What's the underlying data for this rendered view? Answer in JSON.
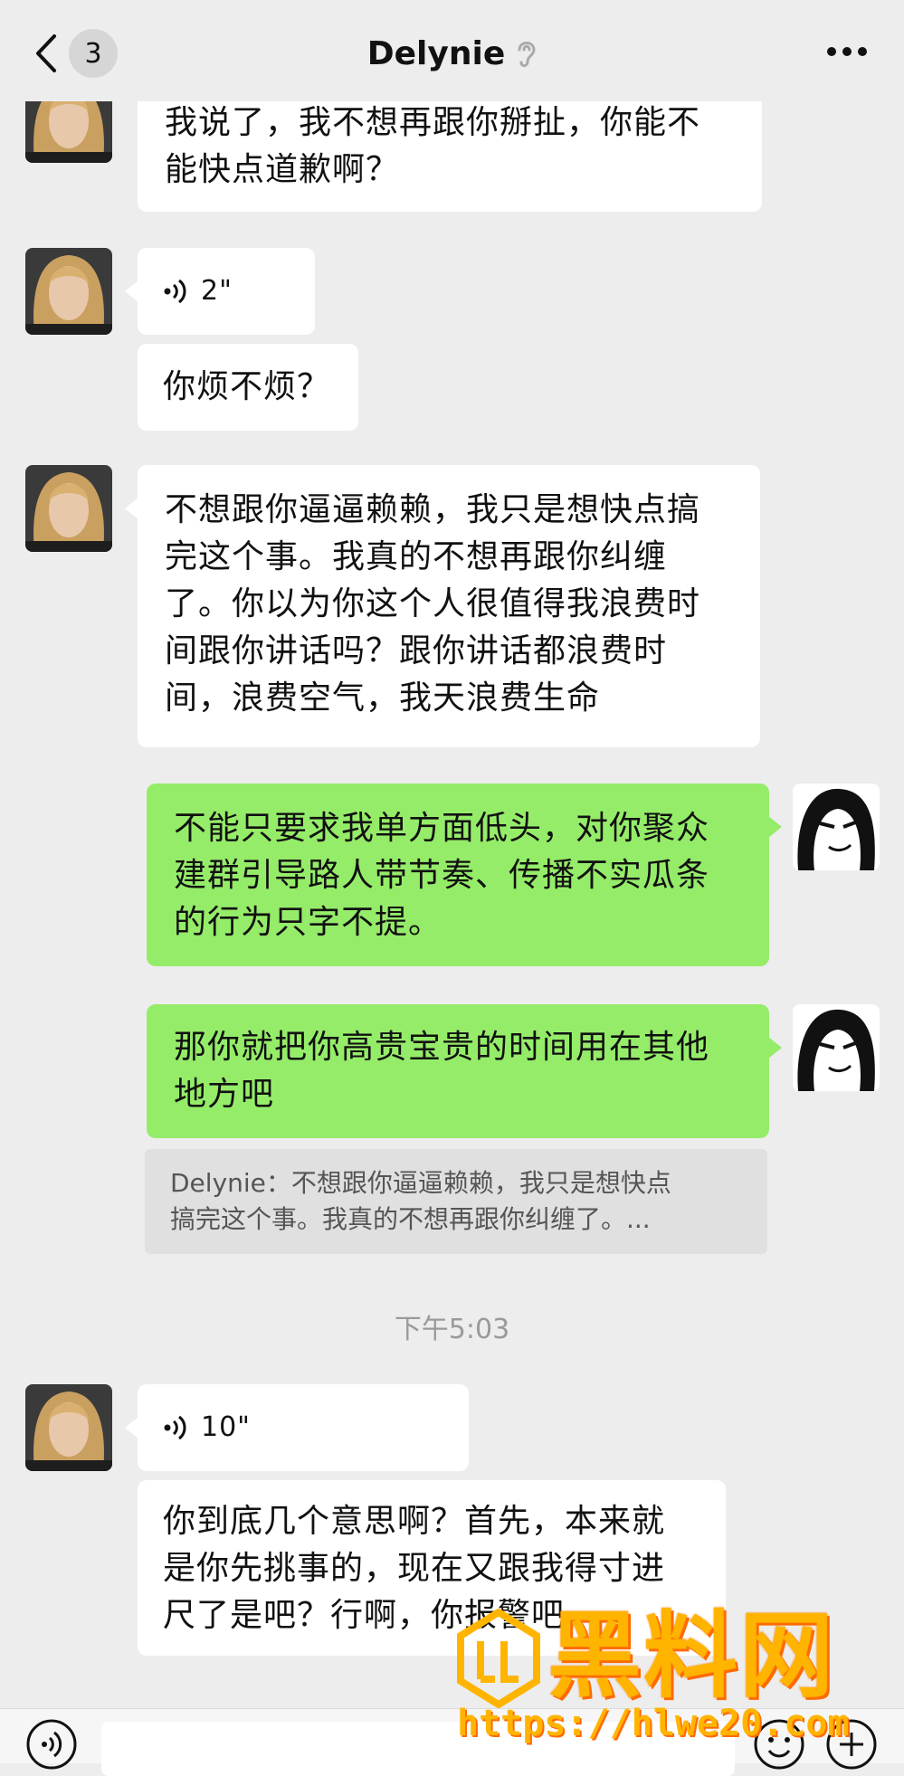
{
  "header": {
    "back_count": "3",
    "title": "Delynie",
    "title_icon": "ear-icon",
    "more_icon": "more-icon"
  },
  "messages": [
    {
      "side": "left",
      "type": "text",
      "text": "我说了，我不想再跟你掰扯，你能不\n能快点道歉啊？"
    },
    {
      "side": "left",
      "type": "voice",
      "duration": "2\""
    },
    {
      "side": "left",
      "type": "text",
      "text": "你烦不烦？"
    },
    {
      "side": "left",
      "type": "text",
      "text": "不想跟你逼逼赖赖，我只是想快点搞\n完这个事。我真的不想再跟你纠缠\n了。你以为你这个人很值得我浪费时\n间跟你讲话吗？跟你讲话都浪费时\n间，浪费空气，我天浪费生命"
    },
    {
      "side": "right",
      "type": "text",
      "text": "不能只要求我单方面低头，对你聚众\n建群引导路人带节奏、传播不实瓜条\n的行为只字不提。"
    },
    {
      "side": "right",
      "type": "text",
      "text": "那你就把你高贵宝贵的时间用在其他\n地方吧"
    },
    {
      "side": "quote",
      "type": "quote",
      "text": "Delynie：不想跟你逼逼赖赖，我只是想快点\n搞完这个事。我真的不想再跟你纠缠了。..."
    },
    {
      "side": "center",
      "type": "time",
      "text": "下午5:03"
    },
    {
      "side": "left",
      "type": "voice",
      "duration": "10\""
    },
    {
      "side": "left",
      "type": "text",
      "text": "你到底几个意思啊？首先，本来就\n是你先挑事的，现在又跟我得寸进\n尺了是吧？行啊，你报警吧"
    }
  ],
  "watermark": {
    "text": "黑料网",
    "url": "https://hlwe20.com"
  },
  "colors": {
    "background": "#ededed",
    "bubble_self": "#95ec69",
    "bubble_other": "#ffffff",
    "watermark": "#ffb400"
  }
}
